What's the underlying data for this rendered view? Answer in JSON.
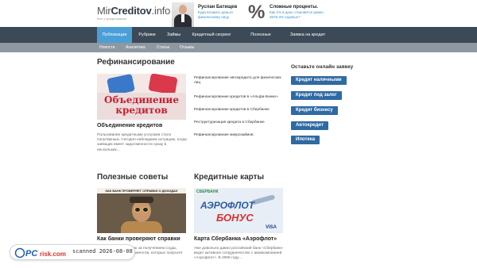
{
  "header": {
    "logo_prefix": "Mir",
    "logo_bold": "Creditov",
    "logo_suffix": ".info",
    "logo_tagline": "Все о кредитовании",
    "promo1": {
      "name": "Руслан Батищев",
      "text": "Куда вложить деньги физическому лицу"
    },
    "promo2": {
      "symbol": "%",
      "title": "Сложные проценты.",
      "text": "Как 1% в день становится равен 3678.3% годовых?"
    }
  },
  "nav": {
    "items": [
      {
        "label": "Публикации",
        "active": true
      },
      {
        "label": "Рубрики",
        "active": false
      },
      {
        "label": "Займы",
        "active": false
      },
      {
        "label": "Кредитный скоринг",
        "active": false
      },
      {
        "label": "Полезные советы",
        "active": false
      },
      {
        "label": "Заявка на кредит",
        "active": false
      }
    ],
    "sub_items": [
      "Новости",
      "Аналитика",
      "Статьи",
      "Отзывы"
    ]
  },
  "main": {
    "section_title": "Рефинансирование",
    "featured": {
      "image_text_line1": "Объединение",
      "image_text_line2": "кредитов",
      "title": "Объединение кредитов",
      "desc": "Пользование кредитными услугами стало популярным. Сегодня наблюдаем ситуацию, когда заёмщик имеет задолженности сразу в нескольких..."
    },
    "links": [
      "Рефинансирование автокредита для физических лиц",
      "Рефинансирование кредитов в «Альфа-Банке»",
      "Рефинансирование кредитов в Сбербанке",
      "Реструктуризация кредита в Сбербанке",
      "Рефинансирование микрозаймов"
    ],
    "tips": {
      "title": "Полезные советы",
      "image_caption": "КАК БАНК ПРОВЕРЯЕТ СПРАВКИ О ДОХОДАХ",
      "card_title": "Как банки проверяют справки",
      "card_desc": "...дитную организацию за получением ссуды, одним из первых документов, которые попросят предоставить..."
    },
    "cards": {
      "title": "Кредитные карты",
      "image_bank": "СБЕРБАНК",
      "image_word1": "АЭРОФЛОТ",
      "image_word2": "БОНУС",
      "image_brand": "VISA",
      "card_title": "Карта Сбербанка «Аэрофлот»",
      "card_desc": "Уже довольно давно российский банк «Сбербанк» ведет активное сотрудничество с авиакомпанией «Аэрофлот». В 2006 году..."
    }
  },
  "sidebar": {
    "title": "Оставьте онлайн заявку",
    "buttons": [
      "Кредит наличными",
      "Кредит под залог",
      "Кредит бизнесу",
      "Автокредит",
      "Ипотека"
    ]
  },
  "watermark": {
    "text": "scanned 2026-08-08"
  },
  "colors": {
    "nav_bg": "#3c4a57",
    "nav_active": "#4b9fd6",
    "subnav_bg": "#8e98a1",
    "button_bg": "#2e6aa3"
  }
}
